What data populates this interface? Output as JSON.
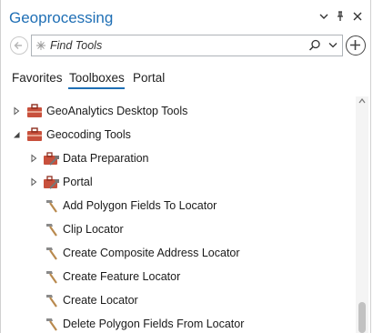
{
  "pane": {
    "title": "Geoprocessing",
    "controls": [
      "chevron-down-icon",
      "pin-icon",
      "close-icon"
    ]
  },
  "search": {
    "placeholder": "Find Tools",
    "icons": [
      "back-arrow-icon",
      "sparkle-icon",
      "search-icon",
      "dropdown-chevron-icon",
      "add-circle-icon"
    ]
  },
  "tabs": [
    {
      "label": "Favorites",
      "active": false
    },
    {
      "label": "Toolboxes",
      "active": true
    },
    {
      "label": "Portal",
      "active": false
    }
  ],
  "tree": [
    {
      "label": "GeoAnalytics Desktop Tools",
      "type": "toolbox",
      "level": 0,
      "expanded": false
    },
    {
      "label": "Geocoding Tools",
      "type": "toolbox",
      "level": 0,
      "expanded": true
    },
    {
      "label": "Data Preparation",
      "type": "toolset",
      "level": 1,
      "expanded": false
    },
    {
      "label": "Portal",
      "type": "toolset",
      "level": 1,
      "expanded": false
    },
    {
      "label": "Add Polygon Fields To Locator",
      "type": "tool",
      "level": 1
    },
    {
      "label": "Clip Locator",
      "type": "tool",
      "level": 1
    },
    {
      "label": "Create Composite Address Locator",
      "type": "tool",
      "level": 1
    },
    {
      "label": "Create Feature Locator",
      "type": "tool",
      "level": 1
    },
    {
      "label": "Create Locator",
      "type": "tool",
      "level": 1
    },
    {
      "label": "Delete Polygon Fields From Locator",
      "type": "tool",
      "level": 1
    }
  ],
  "colors": {
    "accent": "#1f6fb5",
    "toolbox": "#c8503c",
    "hammer_head": "#8a8a8a",
    "hammer_handle": "#b98a4e"
  }
}
